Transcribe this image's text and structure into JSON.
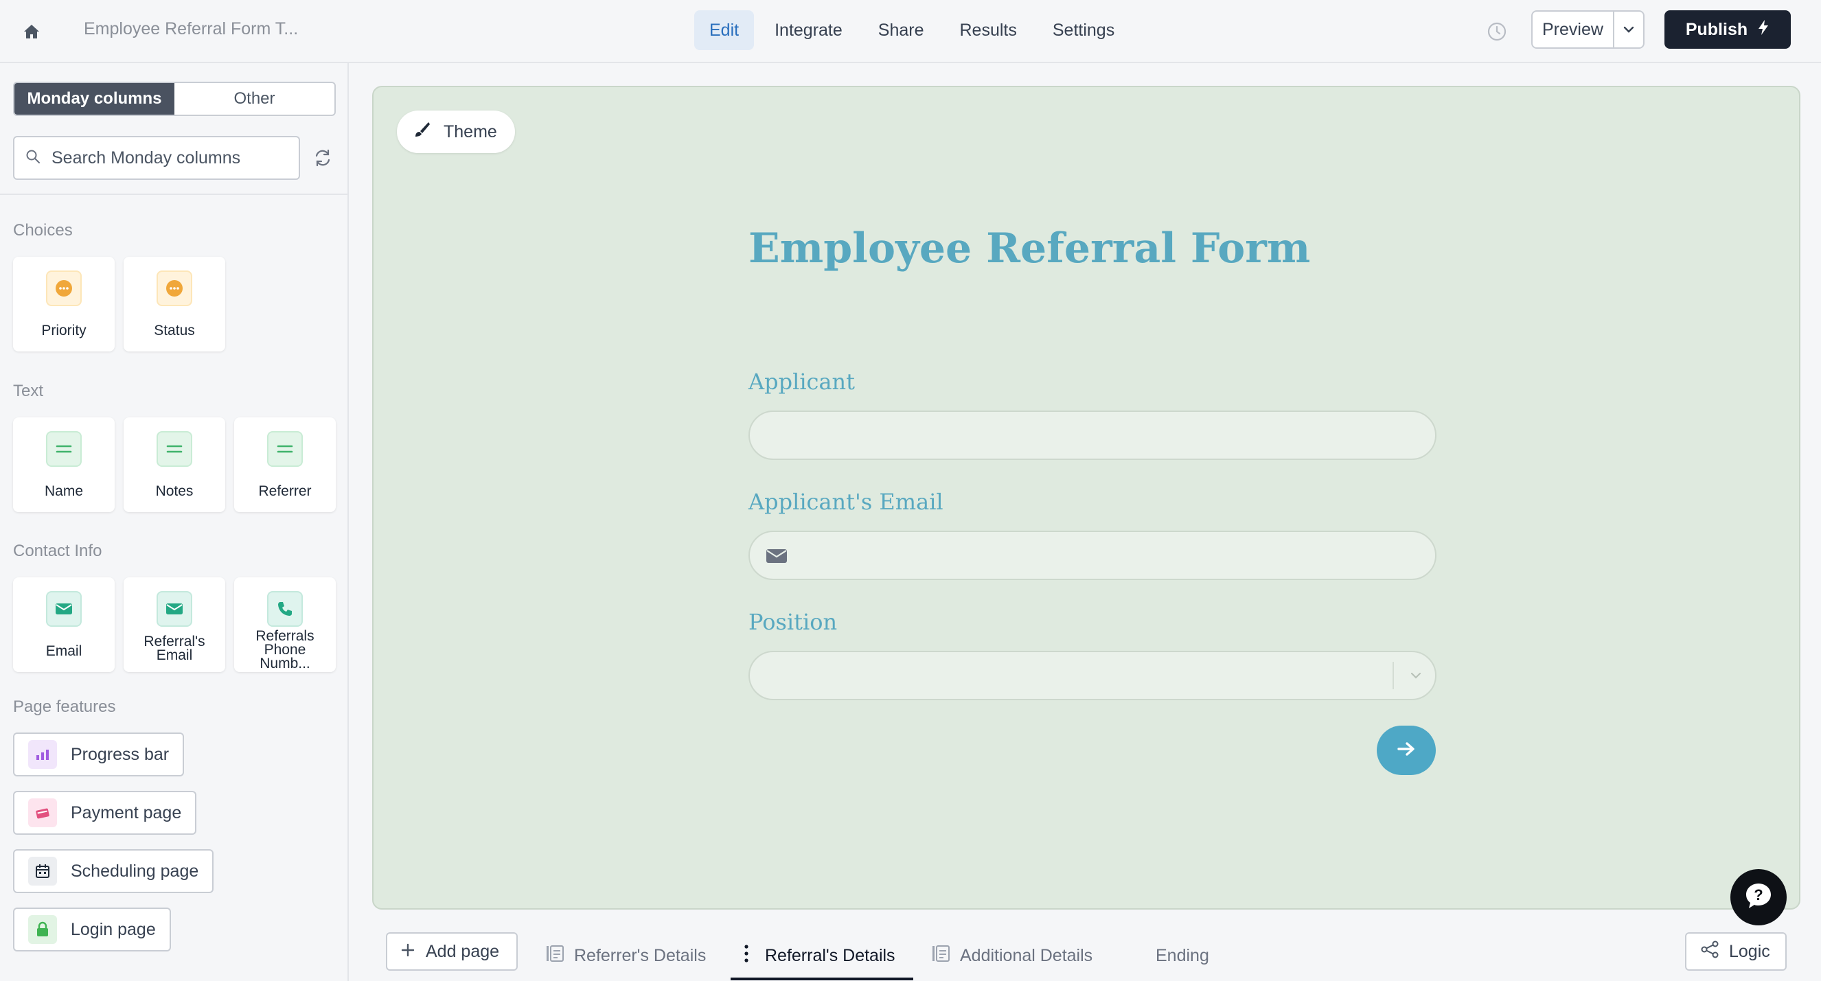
{
  "app": {
    "form_title": "Employee Referral Form T...",
    "nav": [
      "Edit",
      "Integrate",
      "Share",
      "Results",
      "Settings"
    ],
    "active_nav": "Edit",
    "preview_label": "Preview",
    "publish_label": "Publish"
  },
  "sidebar": {
    "tabs": [
      "Monday columns",
      "Other"
    ],
    "search_placeholder": "Search Monday columns",
    "sections": {
      "choices": {
        "label": "Choices",
        "items": [
          "Priority",
          "Status"
        ]
      },
      "text": {
        "label": "Text",
        "items": [
          "Name",
          "Notes",
          "Referrer"
        ]
      },
      "contact": {
        "label": "Contact Info",
        "items": [
          "Email",
          "Referral's Email",
          "Referrals Phone Numb..."
        ]
      },
      "features": {
        "label": "Page features",
        "items": [
          "Progress bar",
          "Payment page",
          "Scheduling page",
          "Login page"
        ]
      }
    }
  },
  "canvas": {
    "theme_label": "Theme",
    "heading": "Employee Referral Form",
    "questions": [
      {
        "label": "Applicant",
        "value": ""
      },
      {
        "label": "Applicant's Email",
        "value": ""
      },
      {
        "label": "Position",
        "value": ""
      }
    ]
  },
  "footer": {
    "add_page_label": "Add page",
    "pages": [
      "Referrer's Details",
      "Referral's Details",
      "Additional Details",
      "Ending"
    ],
    "active_page": "Referral's Details",
    "logic_label": "Logic"
  },
  "colors": {
    "accent": "#58a8c0",
    "canvas_bg": "#dfeadf",
    "publish_bg": "#1b2230",
    "active_nav_bg": "#e2ebf6"
  }
}
